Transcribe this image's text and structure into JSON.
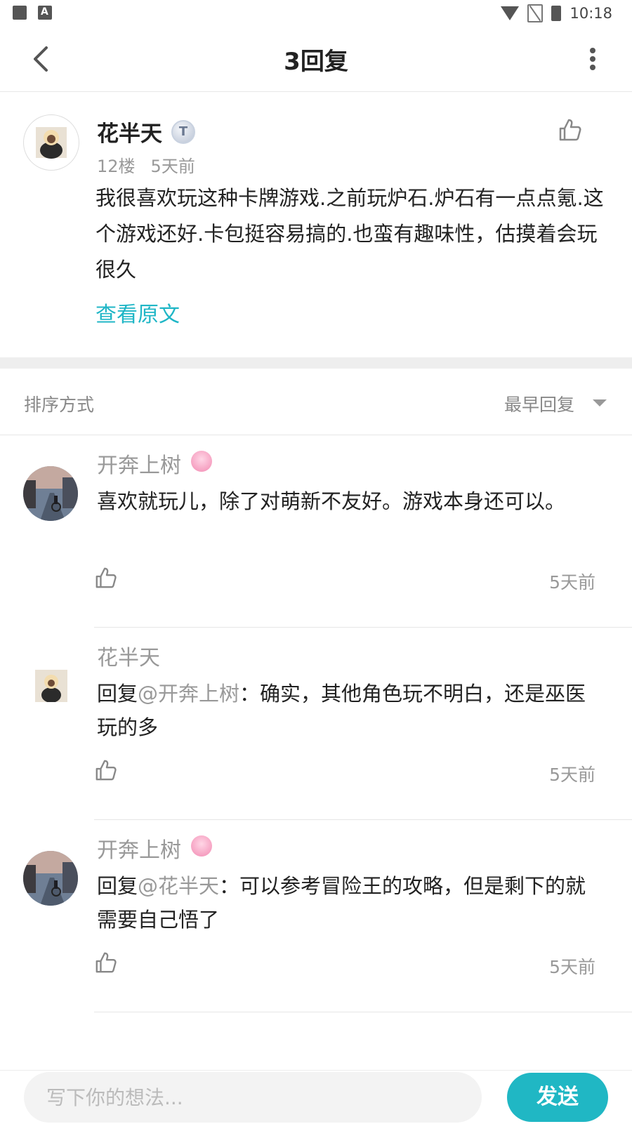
{
  "status_bar": {
    "time": "10:18"
  },
  "header": {
    "title": "3回复"
  },
  "post": {
    "author": "花半天",
    "badge_letter": "T",
    "floor": "12楼",
    "time": "5天前",
    "text": "我很喜欢玩这种卡牌游戏.之前玩炉石.炉石有一点点氪.这个游戏还好.卡包挺容易搞的.也蛮有趣味性，估摸着会玩很久",
    "view_original": "查看原文"
  },
  "sort": {
    "label": "排序方式",
    "value": "最早回复"
  },
  "replies": [
    {
      "name": "开奔上树",
      "prefix": "",
      "mention": "",
      "text": "喜欢就玩儿，除了对萌新不友好。游戏本身还可以。",
      "time": "5天前"
    },
    {
      "name": "花半天",
      "prefix": "回复",
      "mention": "@开奔上树",
      "text": "：确实，其他角色玩不明白，还是巫医玩的多",
      "time": "5天前"
    },
    {
      "name": "开奔上树",
      "prefix": "回复",
      "mention": "@花半天",
      "text": "：可以参考冒险王的攻略，但是剩下的就需要自己悟了",
      "time": "5天前"
    }
  ],
  "composer": {
    "placeholder": "写下你的想法...",
    "send_label": "发送"
  },
  "colors": {
    "accent": "#20b7c4",
    "link": "#1fb6c6",
    "muted": "#999999"
  }
}
